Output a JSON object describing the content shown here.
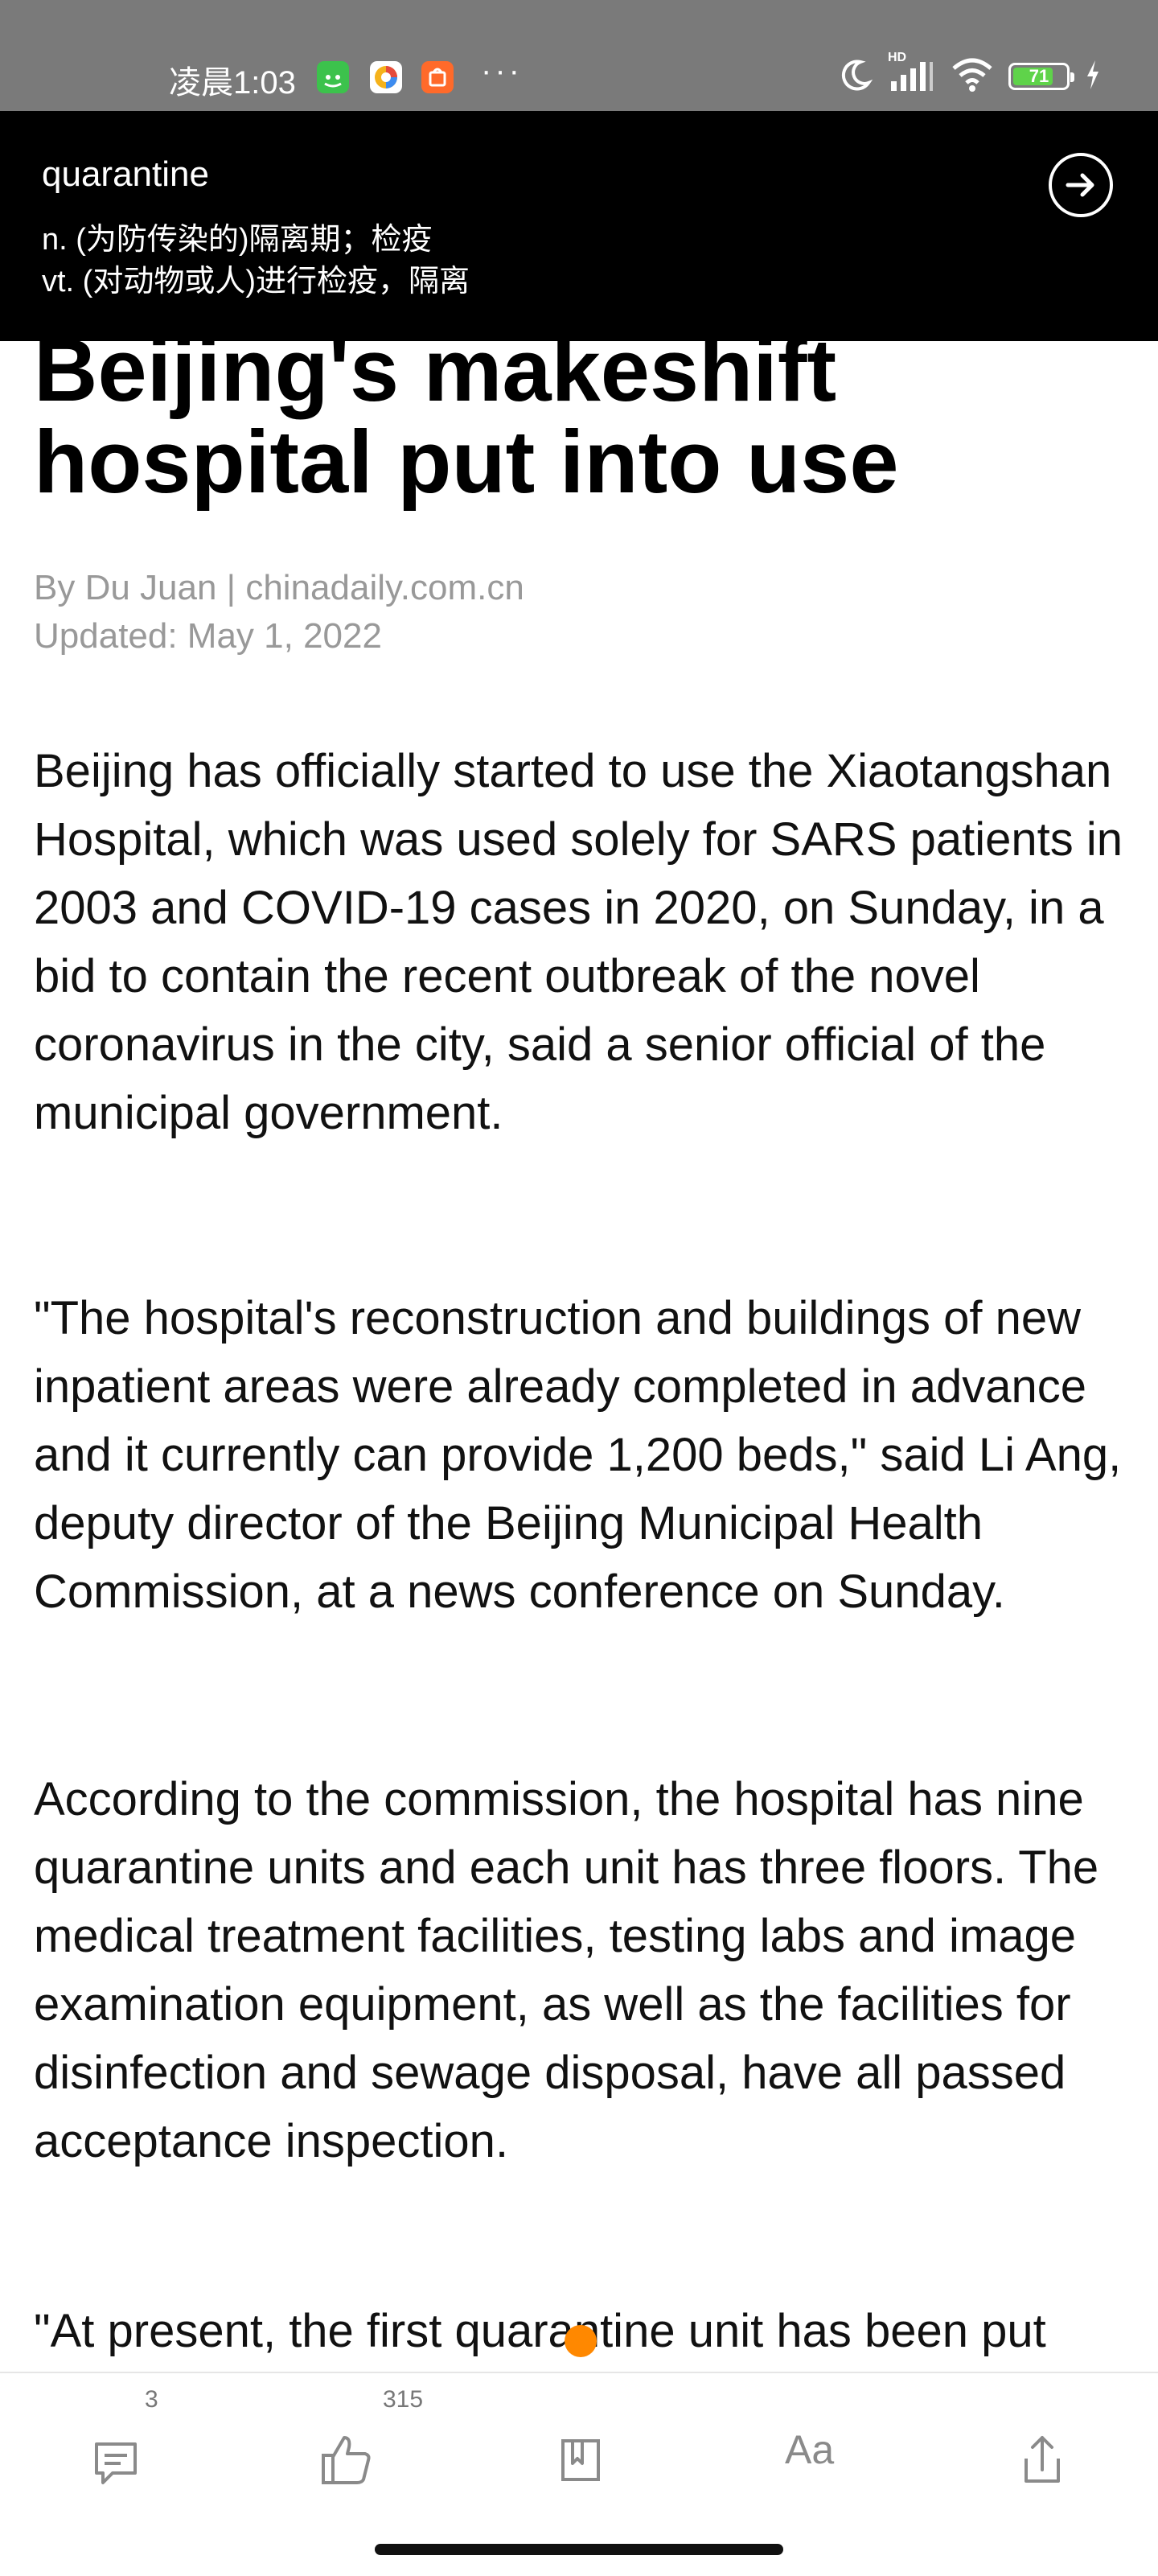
{
  "status_bar": {
    "time": "凌晨1:03",
    "battery": "71",
    "more": "···",
    "hd": "HD"
  },
  "dictionary": {
    "word": "quarantine",
    "definitions": [
      "n. (为防传染的)隔离期；检疫",
      "vt. (对动物或人)进行检疫，隔离"
    ]
  },
  "article": {
    "headline": "Beijing's makeshift hospital put into use",
    "byline": "By Du Juan | chinadaily.com.cn",
    "updated": "Updated: May 1, 2022",
    "paragraphs": [
      "Beijing has officially started to use the Xiaotangshan Hospital, which was used solely for SARS patients in 2003 and COVID-19 cases in 2020, on Sunday, in a bid to contain the recent outbreak of the novel coronavirus in the city, said a senior official of the municipal government.",
      "\"The hospital's reconstruction and buildings of new inpatient areas were already completed in advance and it currently can provide 1,200 beds,\" said Li Ang, deputy director of the Beijing Municipal Health Commission, at a news conference on Sunday.",
      "According to the commission, the hospital has nine quarantine units and each unit has three floors. The medical treatment facilities, testing labs and image examination equipment, as well as the facilities for disinfection and sewage disposal, have all passed acceptance inspection.",
      "\"At present, the first quarantine unit has been put"
    ]
  },
  "toolbar": {
    "comment_count": "3",
    "like_count": "315",
    "font_label": "Aa"
  },
  "colors": {
    "status_bar_bg": "#7a7a7a",
    "popup_bg": "#000000",
    "meta_text": "#999999",
    "marker": "#ff8800",
    "battery_fill": "#5fd34a"
  }
}
